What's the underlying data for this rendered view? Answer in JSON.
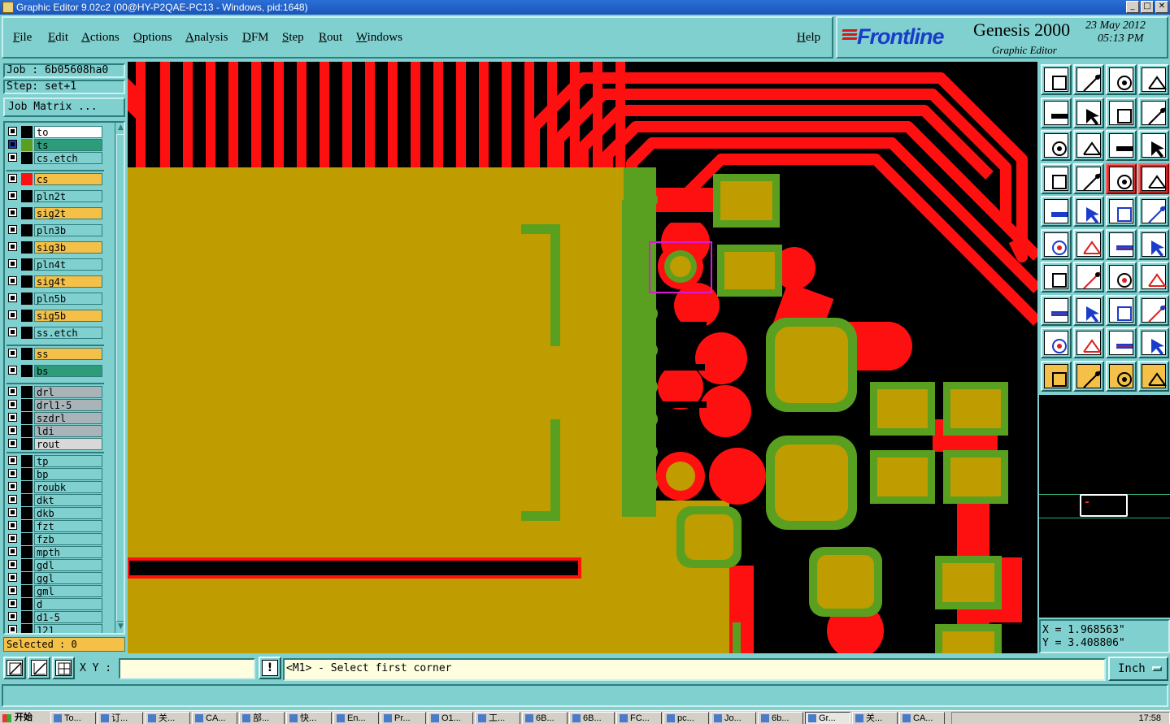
{
  "window": {
    "title": "Graphic Editor 9.02c2 (00@HY-P2QAE-PC13 - Windows, pid:1648)",
    "buttons": [
      "minimize",
      "maximize",
      "close"
    ]
  },
  "menubar": {
    "items": [
      "File",
      "Edit",
      "Actions",
      "Options",
      "Analysis",
      "DFM",
      "Step",
      "Rout",
      "Windows"
    ],
    "help": "Help"
  },
  "brand": {
    "logo": "Frontline",
    "product": "Genesis 2000",
    "subtitle": "Graphic Editor",
    "date": "23 May 2012",
    "time": "05:13 PM"
  },
  "job": {
    "job_label": "Job : 6b05608ha0",
    "step_label": "Step: set+1",
    "matrix_button": "Job Matrix ..."
  },
  "layers": [
    {
      "name": "to",
      "swatch": "#000000",
      "bg": "#ffffff"
    },
    {
      "name": "ts",
      "swatch": "#5aa020",
      "bg": "#2e9c7a",
      "selected": true
    },
    {
      "name": "cs.etch",
      "swatch": "#000000",
      "bg": "#7fd0cf"
    },
    {
      "name": "cs",
      "swatch": "#ff1010",
      "bg": "#f5c048"
    },
    {
      "name": "pln2t",
      "swatch": "#000000",
      "bg": "#7fd0cf"
    },
    {
      "name": "sig2t",
      "swatch": "#000000",
      "bg": "#f5c048"
    },
    {
      "name": "pln3b",
      "swatch": "#000000",
      "bg": "#7fd0cf"
    },
    {
      "name": "sig3b",
      "swatch": "#000000",
      "bg": "#f5c048"
    },
    {
      "name": "pln4t",
      "swatch": "#000000",
      "bg": "#7fd0cf"
    },
    {
      "name": "sig4t",
      "swatch": "#000000",
      "bg": "#f5c048"
    },
    {
      "name": "pln5b",
      "swatch": "#000000",
      "bg": "#7fd0cf"
    },
    {
      "name": "sig5b",
      "swatch": "#000000",
      "bg": "#f5c048"
    },
    {
      "name": "ss.etch",
      "swatch": "#000000",
      "bg": "#7fd0cf"
    },
    {
      "name": "ss",
      "swatch": "#000000",
      "bg": "#f5c048"
    },
    {
      "name": "bs",
      "swatch": "#000000",
      "bg": "#2e9c7a"
    },
    {
      "name": "drl",
      "swatch": "#000000",
      "bg": "#a8b4b8"
    },
    {
      "name": "drl1-5",
      "swatch": "#000000",
      "bg": "#a8b4b8"
    },
    {
      "name": "szdrl",
      "swatch": "#000000",
      "bg": "#a8b4b8"
    },
    {
      "name": "ldi",
      "swatch": "#000000",
      "bg": "#a8b4b8"
    },
    {
      "name": "rout",
      "swatch": "#000000",
      "bg": "#d8d8d8"
    },
    {
      "name": "tp",
      "swatch": "#000000",
      "bg": "#7fd0cf"
    },
    {
      "name": "bp",
      "swatch": "#000000",
      "bg": "#7fd0cf"
    },
    {
      "name": "roubk",
      "swatch": "#000000",
      "bg": "#7fd0cf"
    },
    {
      "name": "dkt",
      "swatch": "#000000",
      "bg": "#7fd0cf"
    },
    {
      "name": "dkb",
      "swatch": "#000000",
      "bg": "#7fd0cf"
    },
    {
      "name": "fzt",
      "swatch": "#000000",
      "bg": "#7fd0cf"
    },
    {
      "name": "fzb",
      "swatch": "#000000",
      "bg": "#7fd0cf"
    },
    {
      "name": "mpth",
      "swatch": "#000000",
      "bg": "#7fd0cf"
    },
    {
      "name": "gdl",
      "swatch": "#000000",
      "bg": "#7fd0cf"
    },
    {
      "name": "ggl",
      "swatch": "#000000",
      "bg": "#7fd0cf"
    },
    {
      "name": "gml",
      "swatch": "#000000",
      "bg": "#7fd0cf"
    },
    {
      "name": "d",
      "swatch": "#000000",
      "bg": "#7fd0cf"
    },
    {
      "name": "d1-5",
      "swatch": "#000000",
      "bg": "#7fd0cf"
    },
    {
      "name": "121",
      "swatch": "#000000",
      "bg": "#7fd0cf"
    }
  ],
  "status": {
    "selected": "Selected : 0",
    "x": "X = 1.968563\"",
    "y": "Y = 3.408806\""
  },
  "command": {
    "xy_label": "X Y :",
    "xy_value": "",
    "prompt": "<M1> - Select first corner",
    "units": "Inch"
  },
  "taskbar": {
    "start": "开始",
    "items": [
      "To...",
      "订...",
      "关...",
      "CA...",
      "部...",
      "快...",
      "En...",
      "Pr...",
      "O1...",
      "工...",
      "6B...",
      "6B...",
      "FC...",
      "pc...",
      "Jo...",
      "6b...",
      "Gr...",
      "关...",
      "CA..."
    ],
    "active_index": 16,
    "clock": "17:58"
  },
  "colors": {
    "panel": "#7fd0cf",
    "copper": "#ff1010",
    "mask": "#5aa020",
    "overlap": "#bf9c00",
    "canvas_bg": "#000000"
  }
}
